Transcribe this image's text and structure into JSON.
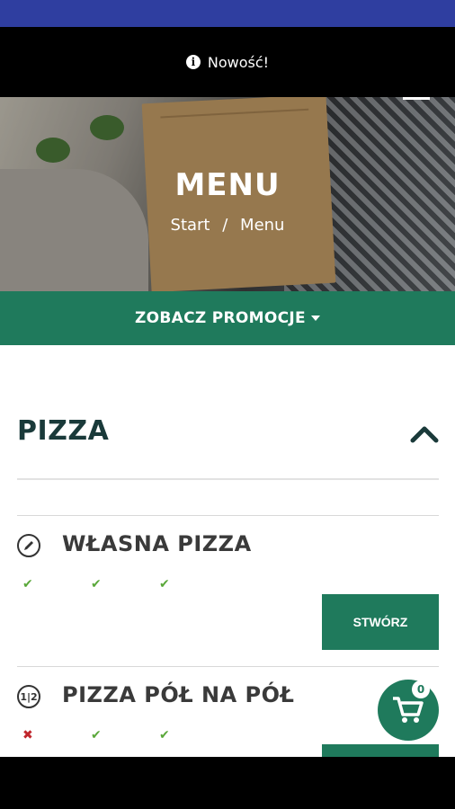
{
  "notice": {
    "text": "Nowość!",
    "icon": "info-icon"
  },
  "hero": {
    "title": "MENU",
    "breadcrumb": [
      "Start",
      "/",
      "Menu"
    ]
  },
  "promo": {
    "label": "ZOBACZ PROMOCJE"
  },
  "section": {
    "title": "PIZZA"
  },
  "products": [
    {
      "name": "WŁASNA PIZZA",
      "icon": "pencil-icon",
      "flags": [
        "✔",
        "✔",
        "✔"
      ],
      "button": "STWÓRZ"
    },
    {
      "name": "PIZZA PÓŁ NA PÓŁ",
      "icon_text": "1|2",
      "flags": [
        "✖",
        "✔",
        "✔"
      ]
    }
  ],
  "cart": {
    "count": "0"
  },
  "colors": {
    "brand_green": "#1f7a5c",
    "status_blue": "#2f3ea0",
    "check_green": "#5aa83a",
    "cross_red": "#c0262c"
  }
}
